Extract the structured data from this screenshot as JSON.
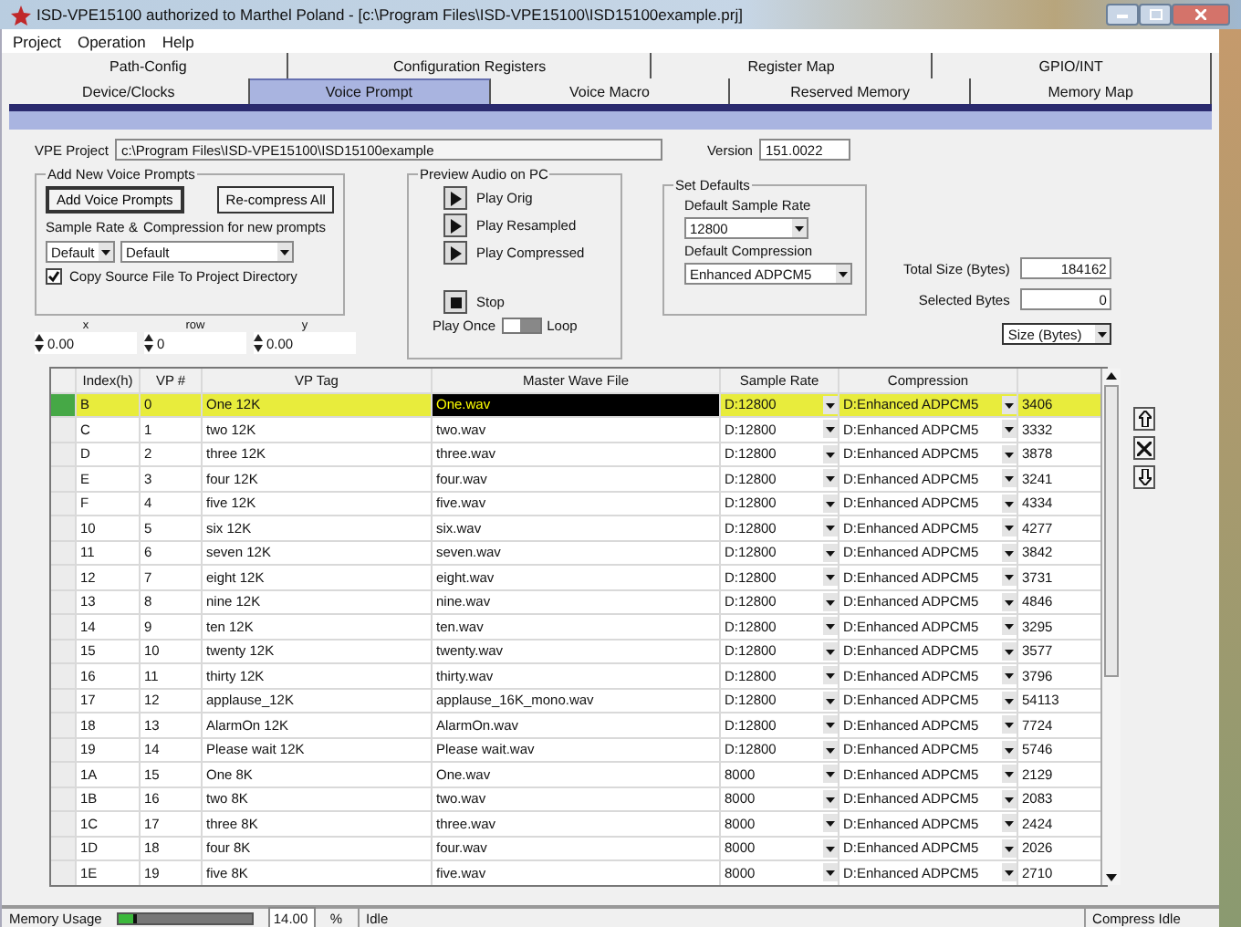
{
  "window": {
    "title": "ISD-VPE15100 authorized to Marthel Poland - [c:\\Program Files\\ISD-VPE15100\\ISD15100example.prj]"
  },
  "menu": [
    "Project",
    "Operation",
    "Help"
  ],
  "tabs_back": [
    {
      "label": "Path-Config",
      "selected": false
    },
    {
      "label": "Configuration Registers",
      "selected": false
    },
    {
      "label": "Register Map",
      "selected": false
    },
    {
      "label": "GPIO/INT",
      "selected": false
    }
  ],
  "tabs_front": [
    {
      "label": "Device/Clocks",
      "selected": false
    },
    {
      "label": "Voice Prompt",
      "selected": true
    },
    {
      "label": "Voice Macro",
      "selected": false
    },
    {
      "label": "Reserved Memory",
      "selected": false
    },
    {
      "label": "Memory Map",
      "selected": false
    }
  ],
  "project": {
    "label": "VPE Project",
    "value": "c:\\Program Files\\ISD-VPE15100\\ISD15100example",
    "version_label": "Version",
    "version": "151.0022"
  },
  "add_group": {
    "title": "Add New Voice Prompts",
    "add_button": "Add Voice Prompts",
    "recompress_button": "Re-compress All",
    "rate_label": "Sample Rate &",
    "compression_label": "Compression for new prompts",
    "rate_value": "Default",
    "compression_value": "Default",
    "copy_label": "Copy Source File To Project Directory",
    "copy_checked": true
  },
  "spinners": [
    {
      "label": "x",
      "value": "0.00"
    },
    {
      "label": "row",
      "value": "0"
    },
    {
      "label": "y",
      "value": "0.00"
    }
  ],
  "preview": {
    "title": "Preview Audio on PC",
    "buttons": [
      "Play Orig",
      "Play Resampled",
      "Play Compressed"
    ],
    "stop": "Stop",
    "once_label": "Play Once",
    "loop_label": "Loop",
    "loop": true
  },
  "defaults": {
    "title": "Set Defaults",
    "rate_label": "Default Sample Rate",
    "rate_value": "12800",
    "compression_label": "Default Compression",
    "compression_value": "Enhanced ADPCM5"
  },
  "totals": {
    "total_label": "Total Size (Bytes)",
    "total": "184162",
    "selected_label": "Selected Bytes",
    "selected": "0",
    "unit": "Size (Bytes)"
  },
  "table": {
    "columns": [
      "Index(h)",
      "VP #",
      "VP Tag",
      "Master Wave File",
      "Sample Rate",
      "Compression"
    ],
    "rows": [
      {
        "index": "B",
        "vp": "0",
        "tag": "One 12K",
        "file": "One.wav",
        "rate": "D:12800",
        "compression": "D:Enhanced ADPCM5",
        "size": "3406",
        "selected": true
      },
      {
        "index": "C",
        "vp": "1",
        "tag": "two 12K",
        "file": "two.wav",
        "rate": "D:12800",
        "compression": "D:Enhanced ADPCM5",
        "size": "3332",
        "selected": false
      },
      {
        "index": "D",
        "vp": "2",
        "tag": "three 12K",
        "file": "three.wav",
        "rate": "D:12800",
        "compression": "D:Enhanced ADPCM5",
        "size": "3878",
        "selected": false
      },
      {
        "index": "E",
        "vp": "3",
        "tag": "four 12K",
        "file": "four.wav",
        "rate": "D:12800",
        "compression": "D:Enhanced ADPCM5",
        "size": "3241",
        "selected": false
      },
      {
        "index": "F",
        "vp": "4",
        "tag": "five 12K",
        "file": "five.wav",
        "rate": "D:12800",
        "compression": "D:Enhanced ADPCM5",
        "size": "4334",
        "selected": false
      },
      {
        "index": "10",
        "vp": "5",
        "tag": "six 12K",
        "file": "six.wav",
        "rate": "D:12800",
        "compression": "D:Enhanced ADPCM5",
        "size": "4277",
        "selected": false
      },
      {
        "index": "11",
        "vp": "6",
        "tag": "seven 12K",
        "file": "seven.wav",
        "rate": "D:12800",
        "compression": "D:Enhanced ADPCM5",
        "size": "3842",
        "selected": false
      },
      {
        "index": "12",
        "vp": "7",
        "tag": "eight 12K",
        "file": "eight.wav",
        "rate": "D:12800",
        "compression": "D:Enhanced ADPCM5",
        "size": "3731",
        "selected": false
      },
      {
        "index": "13",
        "vp": "8",
        "tag": "nine 12K",
        "file": "nine.wav",
        "rate": "D:12800",
        "compression": "D:Enhanced ADPCM5",
        "size": "4846",
        "selected": false
      },
      {
        "index": "14",
        "vp": "9",
        "tag": "ten 12K",
        "file": "ten.wav",
        "rate": "D:12800",
        "compression": "D:Enhanced ADPCM5",
        "size": "3295",
        "selected": false
      },
      {
        "index": "15",
        "vp": "10",
        "tag": "twenty 12K",
        "file": "twenty.wav",
        "rate": "D:12800",
        "compression": "D:Enhanced ADPCM5",
        "size": "3577",
        "selected": false
      },
      {
        "index": "16",
        "vp": "11",
        "tag": "thirty 12K",
        "file": "thirty.wav",
        "rate": "D:12800",
        "compression": "D:Enhanced ADPCM5",
        "size": "3796",
        "selected": false
      },
      {
        "index": "17",
        "vp": "12",
        "tag": "applause_12K",
        "file": "applause_16K_mono.wav",
        "rate": "D:12800",
        "compression": "D:Enhanced ADPCM5",
        "size": "54113",
        "selected": false
      },
      {
        "index": "18",
        "vp": "13",
        "tag": "AlarmOn 12K",
        "file": "AlarmOn.wav",
        "rate": "D:12800",
        "compression": "D:Enhanced ADPCM5",
        "size": "7724",
        "selected": false
      },
      {
        "index": "19",
        "vp": "14",
        "tag": "Please wait 12K",
        "file": "Please wait.wav",
        "rate": "D:12800",
        "compression": "D:Enhanced ADPCM5",
        "size": "5746",
        "selected": false
      },
      {
        "index": "1A",
        "vp": "15",
        "tag": "One 8K",
        "file": "One.wav",
        "rate": "8000",
        "compression": "D:Enhanced ADPCM5",
        "size": "2129",
        "selected": false
      },
      {
        "index": "1B",
        "vp": "16",
        "tag": "two 8K",
        "file": "two.wav",
        "rate": "8000",
        "compression": "D:Enhanced ADPCM5",
        "size": "2083",
        "selected": false
      },
      {
        "index": "1C",
        "vp": "17",
        "tag": "three 8K",
        "file": "three.wav",
        "rate": "8000",
        "compression": "D:Enhanced ADPCM5",
        "size": "2424",
        "selected": false
      },
      {
        "index": "1D",
        "vp": "18",
        "tag": "four 8K",
        "file": "four.wav",
        "rate": "8000",
        "compression": "D:Enhanced ADPCM5",
        "size": "2026",
        "selected": false
      },
      {
        "index": "1E",
        "vp": "19",
        "tag": "five 8K",
        "file": "five.wav",
        "rate": "8000",
        "compression": "D:Enhanced ADPCM5",
        "size": "2710",
        "selected": false
      }
    ]
  },
  "status_bar": {
    "memory_label": "Memory Usage",
    "level": 0.14,
    "reading": "14.00",
    "unit": "%",
    "message": "Idle",
    "compress": "Compress Idle"
  }
}
